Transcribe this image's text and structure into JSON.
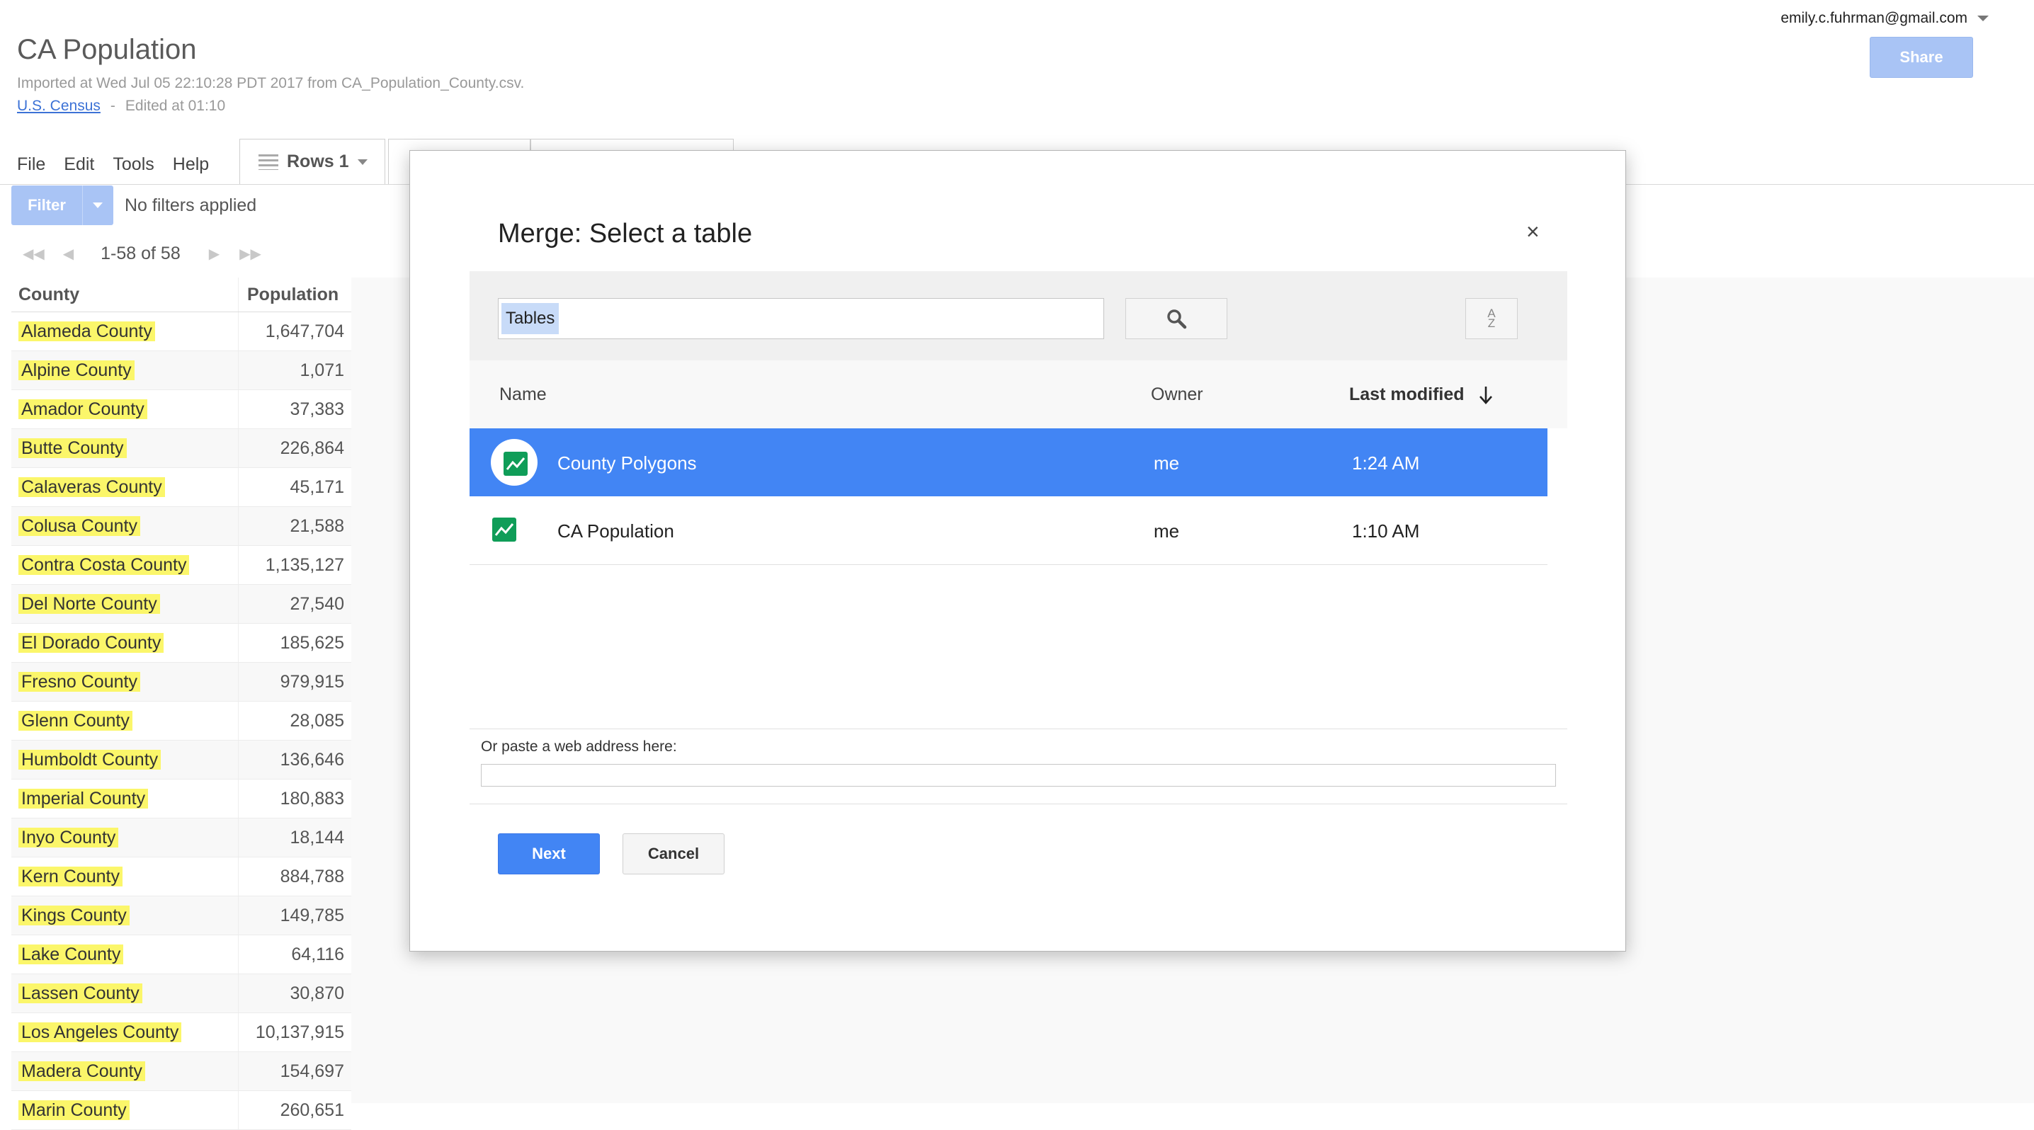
{
  "header": {
    "account": "emily.c.fuhrman@gmail.com",
    "share_label": "Share",
    "title": "CA Population",
    "subtitle": "Imported at Wed Jul 05 22:10:28 PDT 2017 from CA_Population_County.csv.",
    "source_link": "U.S. Census",
    "separator": "-",
    "edited": "Edited at 01:10"
  },
  "menu": {
    "file": "File",
    "edit": "Edit",
    "tools": "Tools",
    "help": "Help"
  },
  "tabs": {
    "rows_label": "Rows 1"
  },
  "filter": {
    "label": "Filter",
    "status": "No filters applied"
  },
  "pager": {
    "range": "1-58 of 58"
  },
  "table": {
    "columns": [
      "County",
      "Population"
    ],
    "rows": [
      [
        "Alameda County",
        "1,647,704"
      ],
      [
        "Alpine County",
        "1,071"
      ],
      [
        "Amador County",
        "37,383"
      ],
      [
        "Butte County",
        "226,864"
      ],
      [
        "Calaveras County",
        "45,171"
      ],
      [
        "Colusa County",
        "21,588"
      ],
      [
        "Contra Costa County",
        "1,135,127"
      ],
      [
        "Del Norte County",
        "27,540"
      ],
      [
        "El Dorado County",
        "185,625"
      ],
      [
        "Fresno County",
        "979,915"
      ],
      [
        "Glenn County",
        "28,085"
      ],
      [
        "Humboldt County",
        "136,646"
      ],
      [
        "Imperial County",
        "180,883"
      ],
      [
        "Inyo County",
        "18,144"
      ],
      [
        "Kern County",
        "884,788"
      ],
      [
        "Kings County",
        "149,785"
      ],
      [
        "Lake County",
        "64,116"
      ],
      [
        "Lassen County",
        "30,870"
      ],
      [
        "Los Angeles County",
        "10,137,915"
      ],
      [
        "Madera County",
        "154,697"
      ],
      [
        "Marin County",
        "260,651"
      ]
    ]
  },
  "dialog": {
    "title": "Merge: Select a table",
    "close_glyph": "×",
    "search_value": "Tables",
    "sort_glyph_top": "A",
    "sort_glyph_bottom": "Z",
    "columns": {
      "name": "Name",
      "owner": "Owner",
      "modified": "Last modified"
    },
    "rows": [
      {
        "name": "County Polygons",
        "owner": "me",
        "modified": "1:24 AM",
        "selected": true
      },
      {
        "name": "CA Population",
        "owner": "me",
        "modified": "1:10 AM",
        "selected": false
      }
    ],
    "url_label": "Or paste a web address here:",
    "url_value": "",
    "next_label": "Next",
    "cancel_label": "Cancel"
  },
  "colors": {
    "accent": "#4285f4",
    "share_disabled": "#a9c4f5",
    "highlight": "#fbf66a",
    "icon_green": "#0f9d58"
  }
}
